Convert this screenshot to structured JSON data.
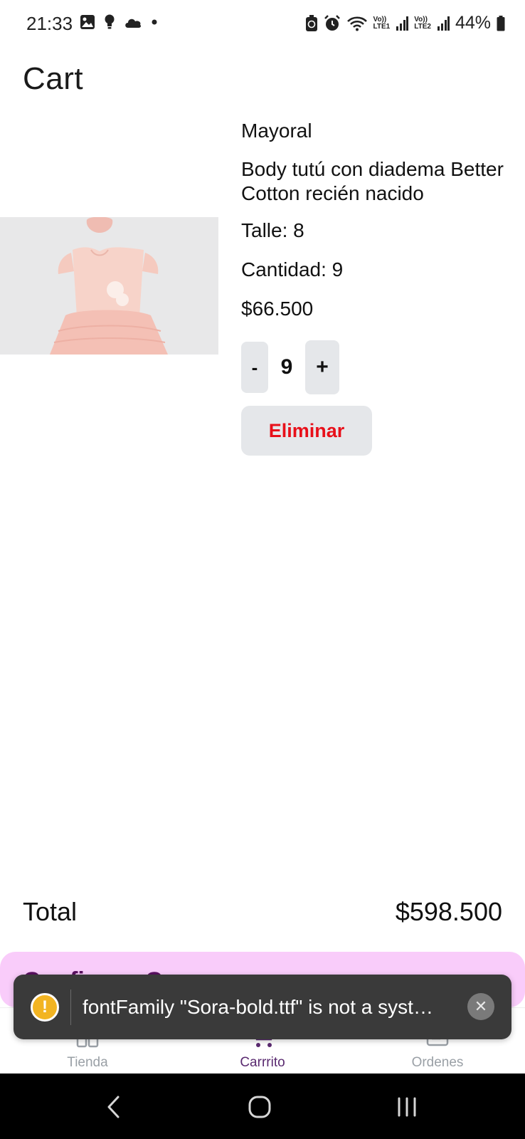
{
  "status_bar": {
    "time": "21:33",
    "battery": "44%",
    "lte1": "LTE1",
    "lte2": "LTE2",
    "volte": "Vo))"
  },
  "page": {
    "title": "Cart"
  },
  "cart_item": {
    "brand": "Mayoral",
    "name": "Body tutú con diadema Better Cotton recién nacido",
    "size": "Talle: 8",
    "quantity_text": "Cantidad: 9",
    "price": "$66.500",
    "stepper": {
      "minus": "-",
      "value": "9",
      "plus": "+"
    },
    "remove_label": "Eliminar"
  },
  "summary": {
    "total_label": "Total",
    "total_value": "$598.500"
  },
  "confirm": {
    "label": "Confirmar Compra"
  },
  "toast": {
    "message": "fontFamily \"Sora-bold.ttf\" is not a syst…",
    "close": "✕",
    "warn": "!"
  },
  "tabs": [
    {
      "label": "Tienda",
      "active": false
    },
    {
      "label": "Carrrito",
      "active": true
    },
    {
      "label": "Ordenes",
      "active": false
    }
  ],
  "colors": {
    "accent": "#5a2a70",
    "confirm_bg": "#f9ccfa",
    "remove_text": "#e8101a",
    "toast_bg": "#3a3a3a",
    "warn": "#f2b422"
  }
}
